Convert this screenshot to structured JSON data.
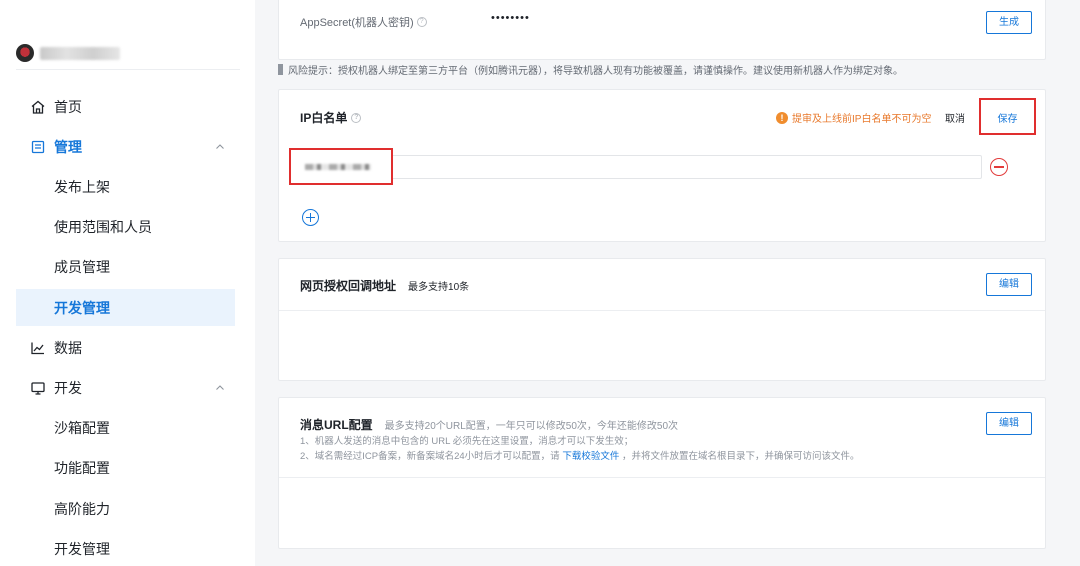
{
  "sidebar": {
    "items": [
      {
        "label": "首页"
      },
      {
        "label": "管理"
      },
      {
        "label": "发布上架"
      },
      {
        "label": "使用范围和人员"
      },
      {
        "label": "成员管理"
      },
      {
        "label": "开发管理"
      },
      {
        "label": "数据"
      },
      {
        "label": "开发"
      },
      {
        "label": "沙箱配置"
      },
      {
        "label": "功能配置"
      },
      {
        "label": "高阶能力"
      },
      {
        "label": "开发管理"
      }
    ]
  },
  "secret": {
    "label": "AppSecret(机器人密钥)",
    "value": "••••••••",
    "generate_label": "生成"
  },
  "risk_notice": "风险提示：授权机器人绑定至第三方平台（例如腾讯元器），将导致机器人现有功能被覆盖，请谨慎操作。建议使用新机器人作为绑定对象。",
  "ip_whitelist": {
    "title": "IP白名单",
    "warning": "提审及上线前IP白名单不可为空",
    "cancel_label": "取消",
    "save_label": "保存"
  },
  "callback": {
    "title": "网页授权回调地址",
    "hint": "最多支持10条",
    "edit_label": "编辑"
  },
  "message_url": {
    "title": "消息URL配置",
    "hint": "最多支持20个URL配置，一年只可以修改50次，今年还能修改50次",
    "line1": "1、机器人发送的消息中包含的 URL 必须先在这里设置，消息才可以下发生效；",
    "line2_prefix": "2、域名需经过ICP备案，新备案域名24小时后才可以配置，请",
    "line2_link": "下载校验文件",
    "line2_suffix": "，并将文件放置在域名根目录下，并确保可访问该文件。",
    "edit_label": "编辑"
  },
  "colors": {
    "accent": "#1677d9",
    "danger": "#e02e2e",
    "warning": "#e8792c"
  }
}
